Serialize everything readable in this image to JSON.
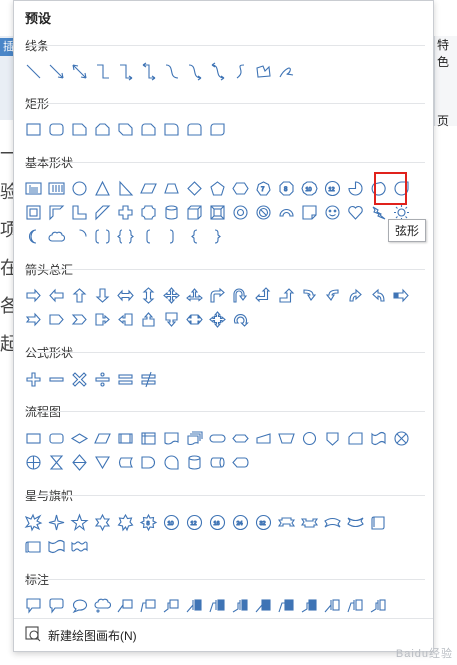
{
  "background": {
    "ribbon_left_label": "插入",
    "ribbon_right_label": "特色",
    "ribbon_right_sub": "页",
    "doc_chars": [
      "一",
      "验",
      "项",
      "在",
      "各",
      "起"
    ]
  },
  "panel": {
    "title": "预设",
    "sections": [
      {
        "label": "线条",
        "row_count": 1
      },
      {
        "label": "矩形",
        "row_count": 1
      },
      {
        "label": "基本形状",
        "row_count": 3
      },
      {
        "label": "箭头总汇",
        "row_count": 2
      },
      {
        "label": "公式形状",
        "row_count": 1
      },
      {
        "label": "流程图",
        "row_count": 2
      },
      {
        "label": "星与旗帜",
        "row_count": 2
      },
      {
        "label": "标注",
        "row_count": 1
      }
    ],
    "tooltip": "弦形",
    "footer_label": "新建绘图画布(N)",
    "watermark": "Baidu经验"
  },
  "icons": {
    "footer_icon": "canvas-icon"
  }
}
